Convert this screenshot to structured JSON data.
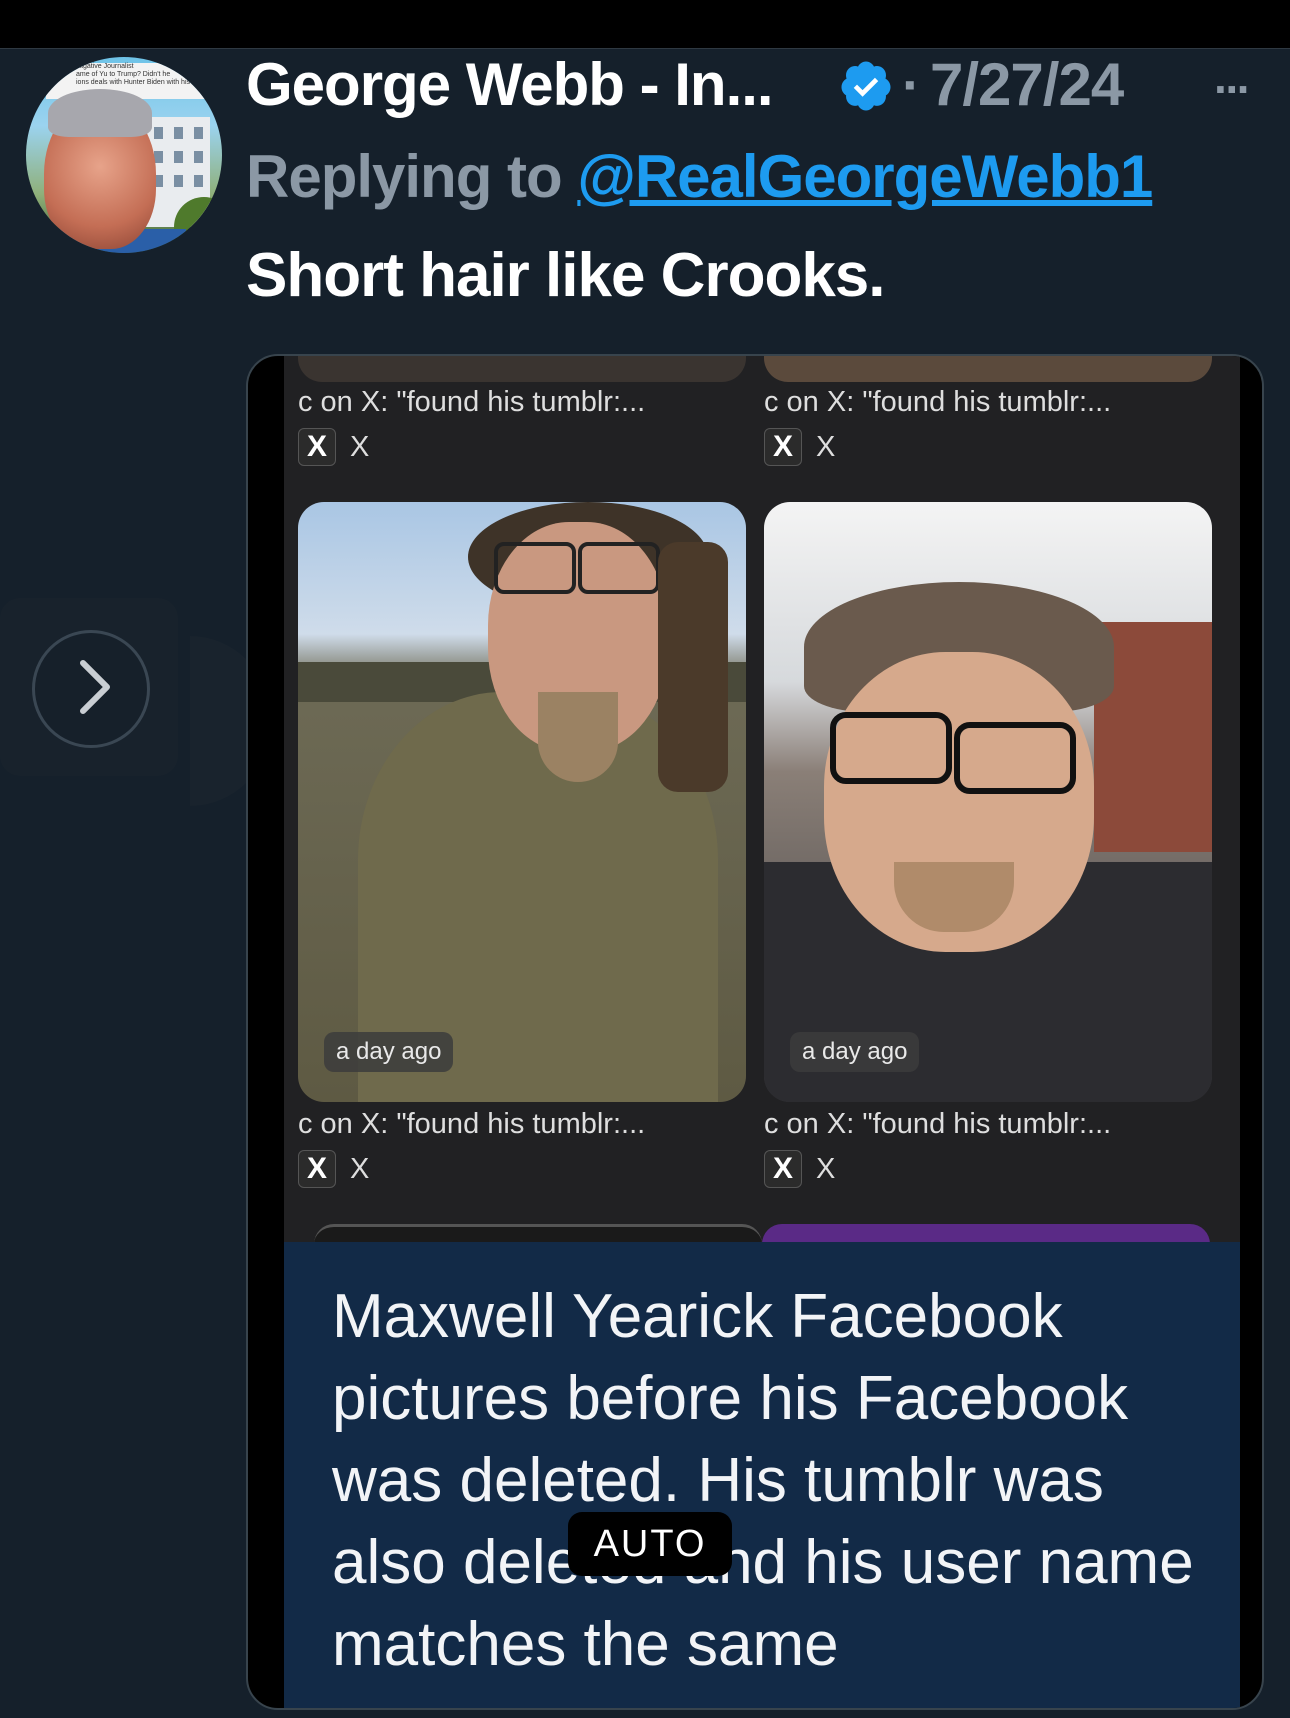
{
  "tweet": {
    "display_name": "George Webb - In...",
    "date_separator": "·",
    "date": "7/27/24",
    "more_label": "···",
    "reply_prefix": "Replying to",
    "reply_handle": "@RealGeorgeWebb1",
    "text": "Short hair like Crooks."
  },
  "avatar": {
    "banner_lines": [
      "stigative Journalist",
      "ame of Yu to Trump? Didn't he",
      "ions deals with Hunter Biden with his e"
    ]
  },
  "media": {
    "results": [
      {
        "caption": "c on X: \"found his tumblr:...",
        "source": "X",
        "source_logo": "X",
        "time": ""
      },
      {
        "caption": "c on X: \"found his tumblr:...",
        "source": "X",
        "source_logo": "X",
        "time": ""
      },
      {
        "caption": "c on X: \"found his tumblr:...",
        "source": "X",
        "source_logo": "X",
        "time": "a day ago"
      },
      {
        "caption": "c on X: \"found his tumblr:...",
        "source": "X",
        "source_logo": "X",
        "time": "a day ago"
      }
    ],
    "overlay_text": "Maxwell Yearick Facebook pictures before his Facebook was deleted. His tumblr was also deleted and his user name matches the same",
    "playback_badge": "AUTO"
  },
  "icons": {
    "verified": "verified-badge-icon",
    "next": "chevron-right-icon",
    "x_logo": "x-logo-icon"
  },
  "colors": {
    "background": "#15202b",
    "accent": "#1d9bf0",
    "muted_text": "#8b98a5",
    "overlay_bg": "#122a47"
  }
}
